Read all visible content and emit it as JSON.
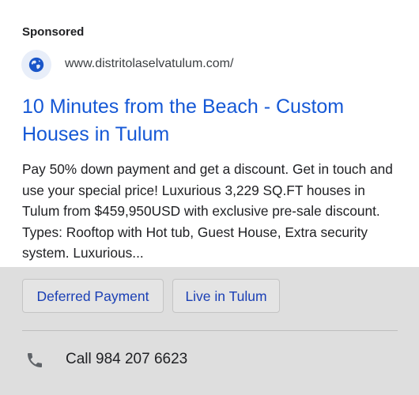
{
  "ad": {
    "sponsored_label": "Sponsored",
    "favicon": "globe-icon",
    "display_url": "www.distritolaselvatulum.com/",
    "headline": "10 Minutes from the Beach - Custom Houses in Tulum",
    "description": "Pay 50% down payment and get a discount. Get in touch and use your special price! Luxurious 3,229 SQ.FT houses in Tulum from $459,950USD with exclusive pre-sale discount. Types: Rooftop with Hot tub, Guest House, Extra security system. Luxurious...",
    "sitelinks": [
      {
        "label": "Deferred Payment"
      },
      {
        "label": "Live in Tulum"
      }
    ],
    "call": {
      "icon": "phone-icon",
      "label": "Call 984 207 6623"
    }
  },
  "colors": {
    "headline": "#1558d6",
    "favicon_bg": "#e8eef9",
    "favicon_glyph": "#1a56c9",
    "background": "#dedede"
  }
}
